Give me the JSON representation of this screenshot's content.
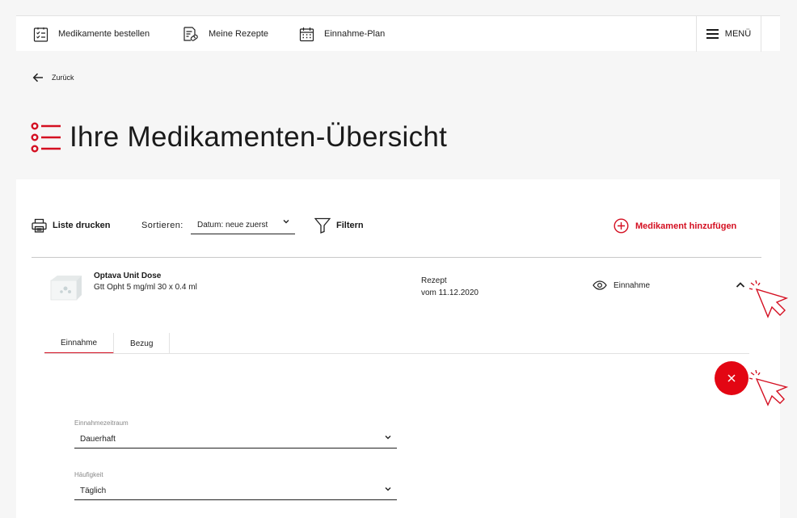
{
  "nav": {
    "items": [
      {
        "label": "Medikamente bestellen",
        "icon": "checklist-icon"
      },
      {
        "label": "Meine Rezepte",
        "icon": "prescription-icon"
      },
      {
        "label": "Einnahme-Plan",
        "icon": "calendar-icon"
      }
    ],
    "menu_label": "MENÜ"
  },
  "back_label": "Zurück",
  "page_title": "Ihre Medikamenten-Übersicht",
  "toolbar": {
    "print_label": "Liste drucken",
    "sort_label": "Sortieren:",
    "sort_value": "Datum: neue zuerst",
    "filter_label": "Filtern",
    "add_label": "Medikament hinzufügen"
  },
  "medication": {
    "name": "Optava Unit Dose",
    "detail": "Gtt Opht 5 mg/ml 30 x 0.4 ml",
    "rx_line1": "Rezept",
    "rx_line2": "vom 11.12.2020",
    "intake_label": "Einnahme"
  },
  "tabs": [
    {
      "label": "Einnahme",
      "active": true
    },
    {
      "label": "Bezug",
      "active": false
    }
  ],
  "form": {
    "period_label": "Einnahmezeitraum",
    "period_value": "Dauerhaft",
    "frequency_label": "Häufigkeit",
    "frequency_value": "Täglich"
  },
  "colors": {
    "accent": "#d40f21",
    "fab": "#e30613",
    "background": "#f6f6f6"
  }
}
